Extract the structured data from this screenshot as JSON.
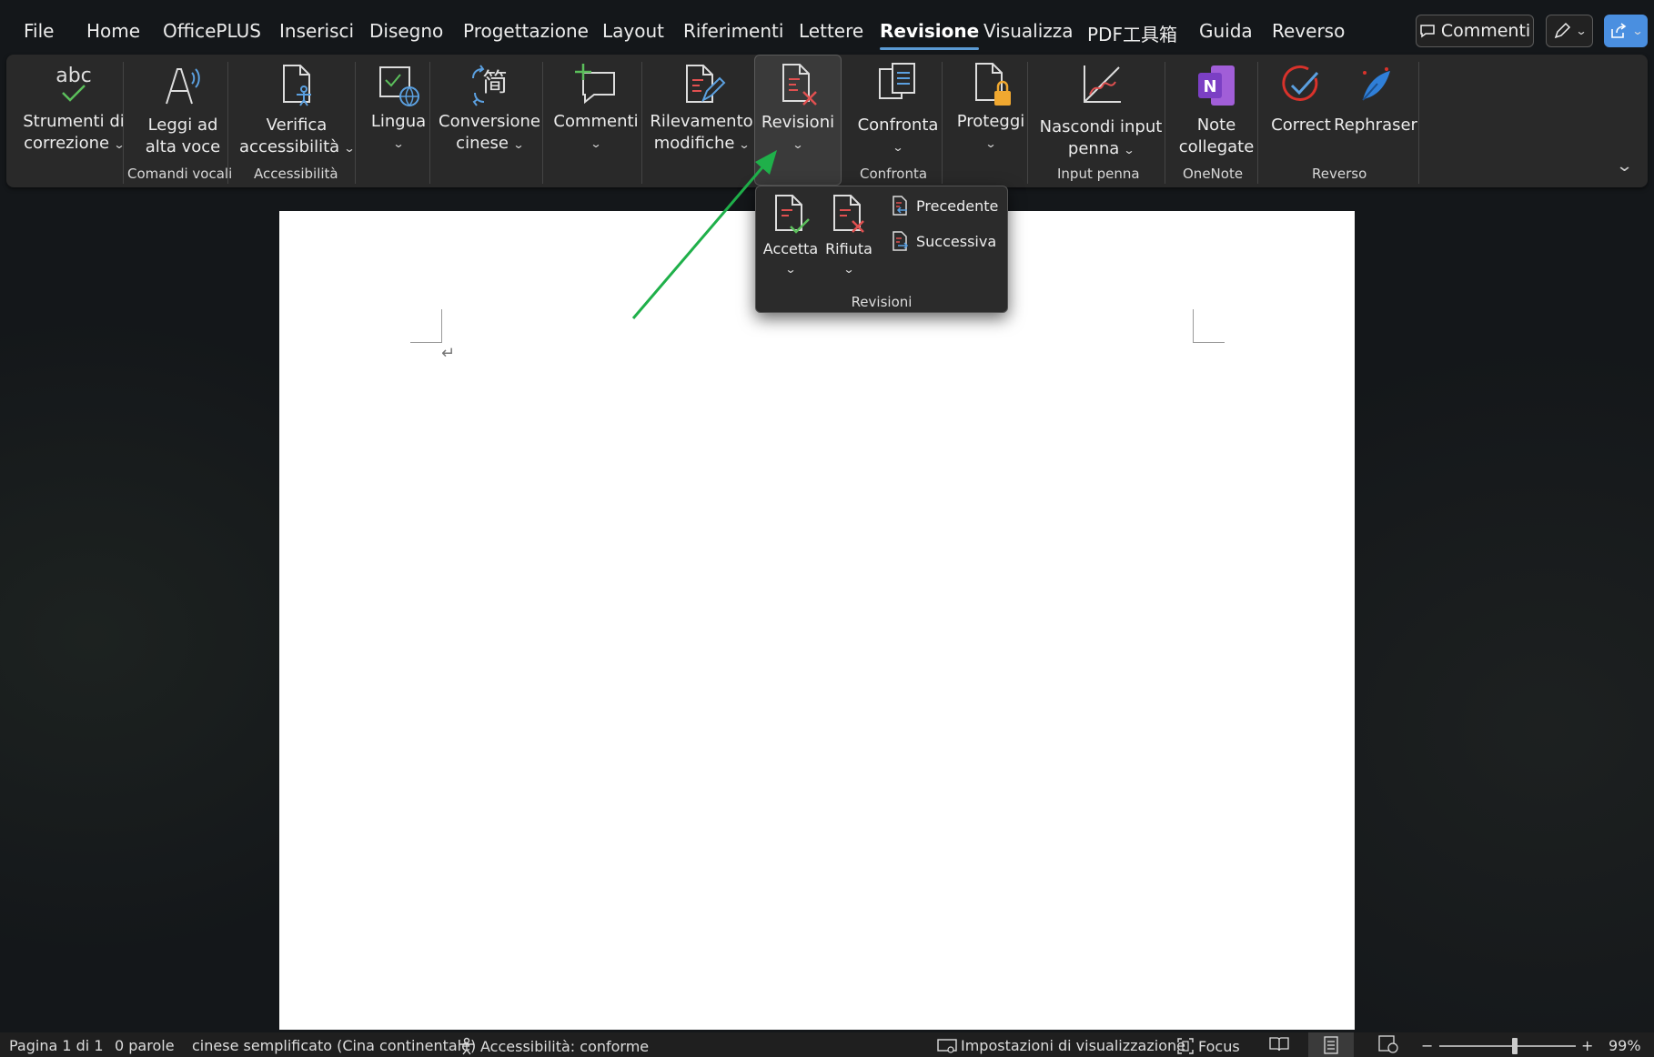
{
  "menu_tabs": [
    "File",
    "Home",
    "OfficePLUS",
    "Inserisci",
    "Disegno",
    "Progettazione",
    "Layout",
    "Riferimenti",
    "Lettere",
    "Revisione",
    "Visualizza",
    "PDF工具箱",
    "Guida",
    "Reverso"
  ],
  "active_tab": "Revisione",
  "top_buttons": {
    "comments_label": "Commenti"
  },
  "ribbon": {
    "strumenti_line1": "Strumenti di",
    "strumenti_line2": "correzione",
    "leggi_line1": "Leggi ad",
    "leggi_line2": "alta voce",
    "verifica_line1": "Verifica",
    "verifica_line2": "accessibilità",
    "lingua": "Lingua",
    "conversione_line1": "Conversione",
    "conversione_line2": "cinese",
    "commenti": "Commenti",
    "rilevamento_line1": "Rilevamento",
    "rilevamento_line2": "modifiche",
    "revisioni": "Revisioni",
    "confronta": "Confronta",
    "proteggi": "Proteggi",
    "nascondi_line1": "Nascondi input",
    "nascondi_line2": "penna",
    "note_line1": "Note",
    "note_line2": "collegate",
    "correct": "Correct",
    "rephraser": "Rephraser",
    "icon_text_abc": "abc",
    "groups": {
      "comandi_vocali": "Comandi vocali",
      "accessibilita": "Accessibilità",
      "confronta": "Confronta",
      "input_penna": "Input penna",
      "onenote": "OneNote",
      "reverso": "Reverso"
    }
  },
  "dropdown": {
    "accetta": "Accetta",
    "rifiuta": "Rifiuta",
    "precedente": "Precedente",
    "successiva": "Successiva",
    "group": "Revisioni"
  },
  "document": {
    "paragraph_mark": "↵"
  },
  "status_bar": {
    "pages": "Pagina 1 di 1",
    "words": "0 parole",
    "language": "cinese semplificato (Cina continentale)",
    "accessibility": "Accessibilità: conforme",
    "display_settings": "Impostazioni di visualizzazione",
    "focus": "Focus",
    "zoom_minus": "−",
    "zoom_plus": "+",
    "zoom": "99%",
    "zoom_fraction": 0.55
  },
  "colors": {
    "accent": "#5b9bd5",
    "arrow": "#1fb04a",
    "onenote": "#7b3fc4",
    "reverso": "#d9322b"
  }
}
